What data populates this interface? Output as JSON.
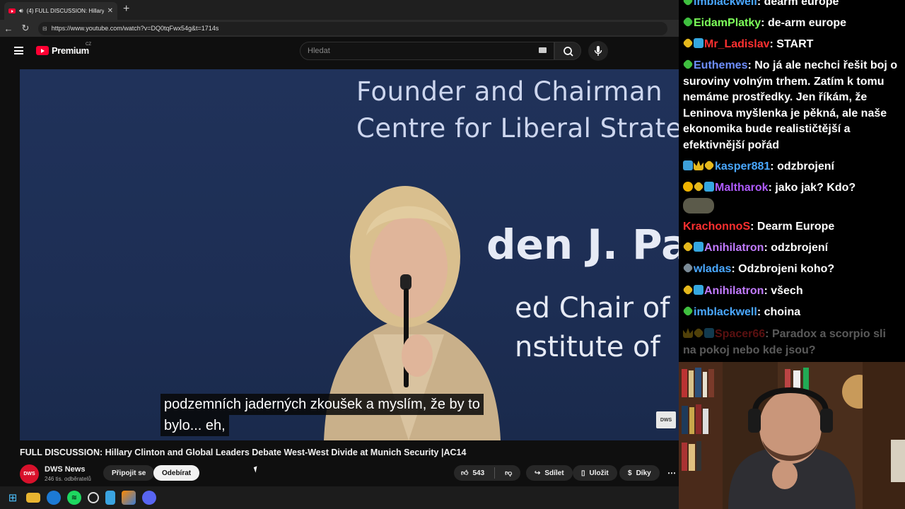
{
  "browser": {
    "tab_title": "(4) FULL DISCUSSION: Hillary",
    "url": "https://www.youtube.com/watch?v=DQ0tqFwx54g&t=1714s"
  },
  "youtube": {
    "logo_text": "Premium",
    "country_code": "CZ",
    "search_placeholder": "Hledat"
  },
  "video": {
    "banner_line1": "Founder and Chairman",
    "banner_line2": "Centre for Liberal Strateg",
    "banner_name": "den J. Pap",
    "banner_line4": "ed Chair of",
    "banner_line5": "nstitute of",
    "watermark": "DWS",
    "subtitle_line1": "podzemních jaderných zkoušek a myslím, že by to",
    "subtitle_line2": "bylo...  eh,",
    "title": "FULL DISCUSSION: Hillary Clinton and Global Leaders Debate West-West Divide at Munich Security |AC14"
  },
  "channel": {
    "avatar_text": "DWS",
    "name": "DWS News",
    "subscribers": "246 tis. odběratelů",
    "join_label": "Připojit se",
    "unsubscribe_label": "Odebírat"
  },
  "actions": {
    "like_count": "543",
    "share_label": "Sdílet",
    "save_label": "Uložit",
    "thanks_label": "Díky"
  },
  "chat": {
    "messages": [
      {
        "user": "imblackwell",
        "color": "#4aa8ff",
        "text": "dearm europe",
        "badges": [
          "green"
        ]
      },
      {
        "user": "EidamPlatky",
        "color": "#7dff5a",
        "text": "de-arm europe",
        "badges": [
          "green"
        ]
      },
      {
        "user": "Mr_Ladislav",
        "color": "#ff3030",
        "text": "START",
        "badges": [
          "gold",
          "blue"
        ]
      },
      {
        "user": "Euthemes",
        "color": "#6f8fff",
        "text": "No já ale nechci řešit boj o suroviny volným trhem. Zatím k tomu nemáme prostředky. Jen říkám, že Leninova myšlenka je pěkná, ale naše ekonomika bude realističtější a efektivnější pořád",
        "badges": [
          "green"
        ]
      },
      {
        "user": "kasper881",
        "color": "#4aa8ff",
        "text": "odzbrojení",
        "badges": [
          "arrow",
          "crown",
          "gold"
        ]
      },
      {
        "user": "Maltharok",
        "color": "#b05cff",
        "text": "jako jak? Kdo?",
        "badges": [
          "coin",
          "gold",
          "blue"
        ]
      },
      {
        "user": "KrachonnoS",
        "color": "#ff3030",
        "text": "Dearm Europe",
        "badges": []
      },
      {
        "user": "Anihilatron",
        "color": "#c27bff",
        "text": "odzbrojení",
        "badges": [
          "gold",
          "blue"
        ]
      },
      {
        "user": "wladas",
        "color": "#4aa8ff",
        "text": "Odzbrojeni koho?",
        "badges": [
          "gray"
        ]
      },
      {
        "user": "Anihilatron",
        "color": "#c27bff",
        "text": "všech",
        "badges": [
          "gold",
          "blue"
        ]
      },
      {
        "user": "imblackwell",
        "color": "#4aa8ff",
        "text": "choina",
        "badges": [
          "green"
        ]
      },
      {
        "user": "Spacer66",
        "color": "#ff3030",
        "text": "Paradox a scorpio sli na pokoj nebo kde jsou?",
        "badges": [
          "crown",
          "gold",
          "blue"
        ]
      }
    ]
  }
}
